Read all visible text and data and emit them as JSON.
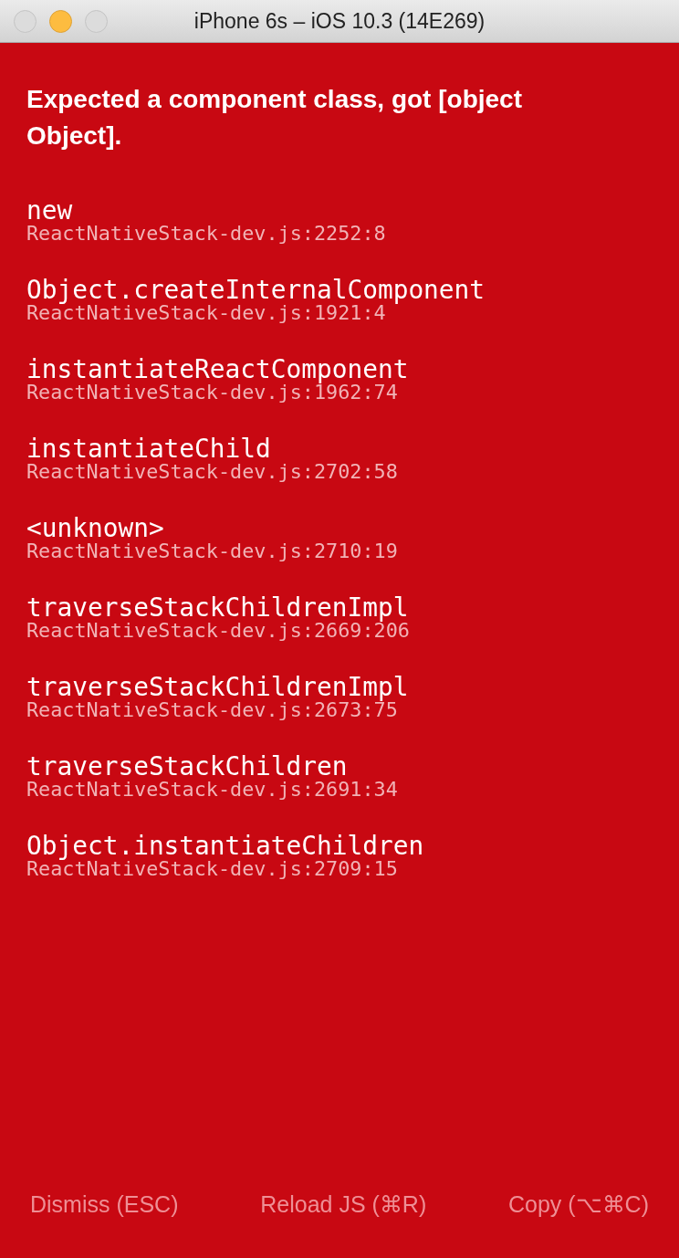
{
  "window": {
    "title": "iPhone 6s – iOS 10.3 (14E269)"
  },
  "error": {
    "message": "Expected a component class, got [object Object]."
  },
  "stack": [
    {
      "method": "new",
      "location": "ReactNativeStack-dev.js:2252:8"
    },
    {
      "method": "Object.createInternalComponent",
      "location": "ReactNativeStack-dev.js:1921:4"
    },
    {
      "method": "instantiateReactComponent",
      "location": "ReactNativeStack-dev.js:1962:74"
    },
    {
      "method": "instantiateChild",
      "location": "ReactNativeStack-dev.js:2702:58"
    },
    {
      "method": "<unknown>",
      "location": "ReactNativeStack-dev.js:2710:19"
    },
    {
      "method": "traverseStackChildrenImpl",
      "location": "ReactNativeStack-dev.js:2669:206"
    },
    {
      "method": "traverseStackChildrenImpl",
      "location": "ReactNativeStack-dev.js:2673:75"
    },
    {
      "method": "traverseStackChildren",
      "location": "ReactNativeStack-dev.js:2691:34"
    },
    {
      "method": "Object.instantiateChildren",
      "location": "ReactNativeStack-dev.js:2709:15"
    }
  ],
  "buttons": [
    {
      "label": "Dismiss (ESC)"
    },
    {
      "label": "Reload JS (⌘R)"
    },
    {
      "label": "Copy (⌥⌘C)"
    }
  ]
}
